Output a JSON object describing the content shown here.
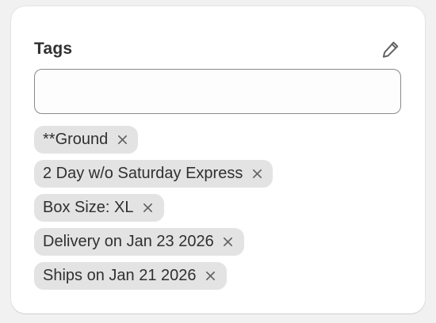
{
  "card": {
    "title": "Tags",
    "edit_icon": "pencil-icon"
  },
  "input": {
    "value": "",
    "placeholder": ""
  },
  "tags": [
    {
      "label": "**Ground"
    },
    {
      "label": "2 Day w/o Saturday Express"
    },
    {
      "label": "Box Size: XL"
    },
    {
      "label": "Delivery on Jan 23 2026"
    },
    {
      "label": "Ships on Jan 21 2026"
    }
  ],
  "colors": {
    "card_background": "#ffffff",
    "page_background": "#f1f1f1",
    "tag_background": "#e3e3e3",
    "text": "#303030",
    "icon": "#616161",
    "input_border": "#8a8a8a"
  }
}
